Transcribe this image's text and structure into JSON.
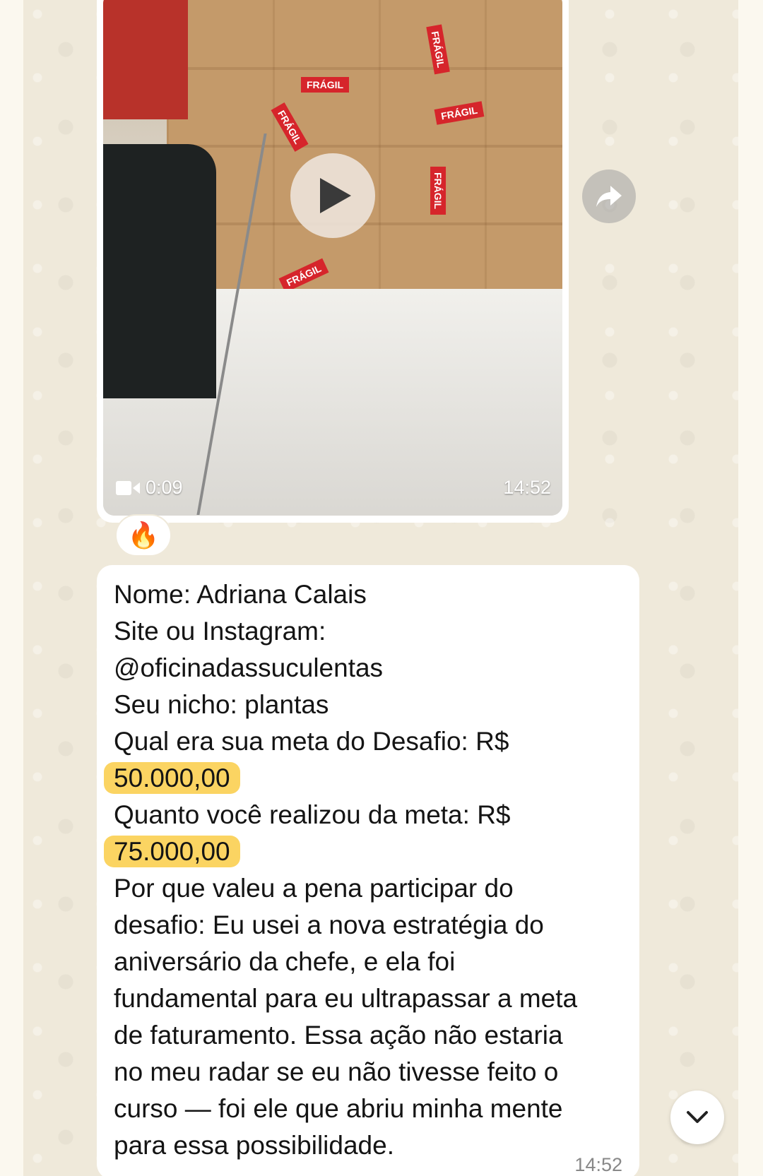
{
  "video_message": {
    "duration": "0:09",
    "time": "14:52",
    "reaction": "🔥",
    "labels": [
      "FRÁGIL",
      "FRÁGIL",
      "FRÁGIL",
      "FRÁGIL",
      "FRÁGIL",
      "FRÁGIL"
    ]
  },
  "text_message": {
    "lines": [
      "Nome: Adriana Calais",
      "Site ou Instagram:",
      "@oficinadassuculentas",
      "Seu nicho: plantas",
      "Qual era sua meta do Desafio: R$",
      "50.000,00",
      "Quanto você realizou da meta: R$",
      "75.000,00",
      "Por que valeu a pena participar do",
      "desafio: Eu usei a nova estratégia do",
      "aniversário da chefe, e ela foi",
      "fundamental para eu ultrapassar a meta",
      "de faturamento. Essa ação não estaria",
      "no meu radar se eu não tivesse feito o",
      "curso — foi ele que abriu minha mente",
      "para essa possibilidade."
    ],
    "time": "14:52"
  },
  "colors": {
    "highlight": "#fbd462",
    "bubble": "#ffffff",
    "chat_background": "#efe9da"
  },
  "icons": [
    "play-icon",
    "video-camera-icon",
    "forward-icon",
    "chevron-down-icon"
  ]
}
